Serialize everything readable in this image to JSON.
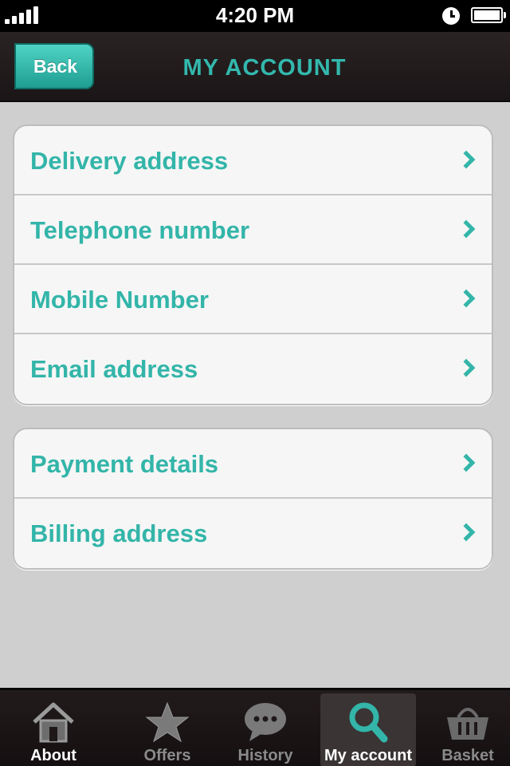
{
  "status": {
    "time": "4:20 PM"
  },
  "navbar": {
    "back_label": "Back",
    "title": "MY ACCOUNT"
  },
  "groups": [
    {
      "rows": [
        {
          "label": "Delivery address"
        },
        {
          "label": "Telephone number"
        },
        {
          "label": "Mobile Number"
        },
        {
          "label": "Email address"
        }
      ]
    },
    {
      "rows": [
        {
          "label": "Payment details"
        },
        {
          "label": "Billing address"
        }
      ]
    }
  ],
  "tabs": [
    {
      "label": "About",
      "icon": "home-icon"
    },
    {
      "label": "Offers",
      "icon": "star-icon"
    },
    {
      "label": "History",
      "icon": "chat-bubble-icon"
    },
    {
      "label": "My account",
      "icon": "search-icon",
      "active": true
    },
    {
      "label": "Basket",
      "icon": "basket-icon"
    }
  ],
  "colors": {
    "accent": "#33b5a9",
    "back_button": "#2fb8aa",
    "background": "#cfcfcf"
  }
}
